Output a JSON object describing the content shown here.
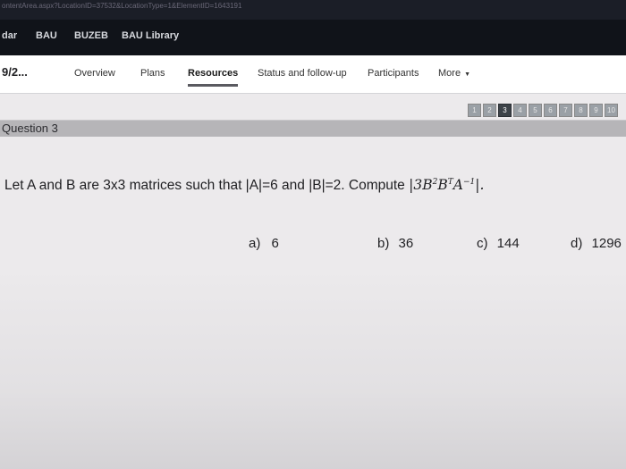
{
  "url_bar": {
    "text": "ontentArea.aspx?LocationID=37532&LocationType=1&ElementID=1643191"
  },
  "top_nav": {
    "items": [
      "dar",
      "BAU",
      "BUZEB",
      "BAU Library"
    ]
  },
  "course_bar": {
    "title": "9/2...",
    "tabs": [
      "Overview",
      "Plans",
      "Resources",
      "Status and follow-up",
      "Participants",
      "More"
    ],
    "active_tab": "Resources"
  },
  "pager": {
    "pages": [
      "1",
      "2",
      "3",
      "4",
      "5",
      "6",
      "7",
      "8",
      "9",
      "10"
    ],
    "current": "3"
  },
  "question": {
    "label": "Question 3",
    "text_prefix": "Let A and B are 3x3 matrices such that |A|=6 and |B|=2. Compute ",
    "expr_open": "|3",
    "expr_b": "B",
    "expr_b_exp": "2",
    "expr_bt": "B",
    "expr_bt_exp": "T",
    "expr_a": "A",
    "expr_a_exp": "−1",
    "expr_close": "|.",
    "options": [
      {
        "letter": "a)",
        "value": "6"
      },
      {
        "letter": "b)",
        "value": "36"
      },
      {
        "letter": "c)",
        "value": "144"
      },
      {
        "letter": "d)",
        "value": "1296"
      }
    ]
  }
}
